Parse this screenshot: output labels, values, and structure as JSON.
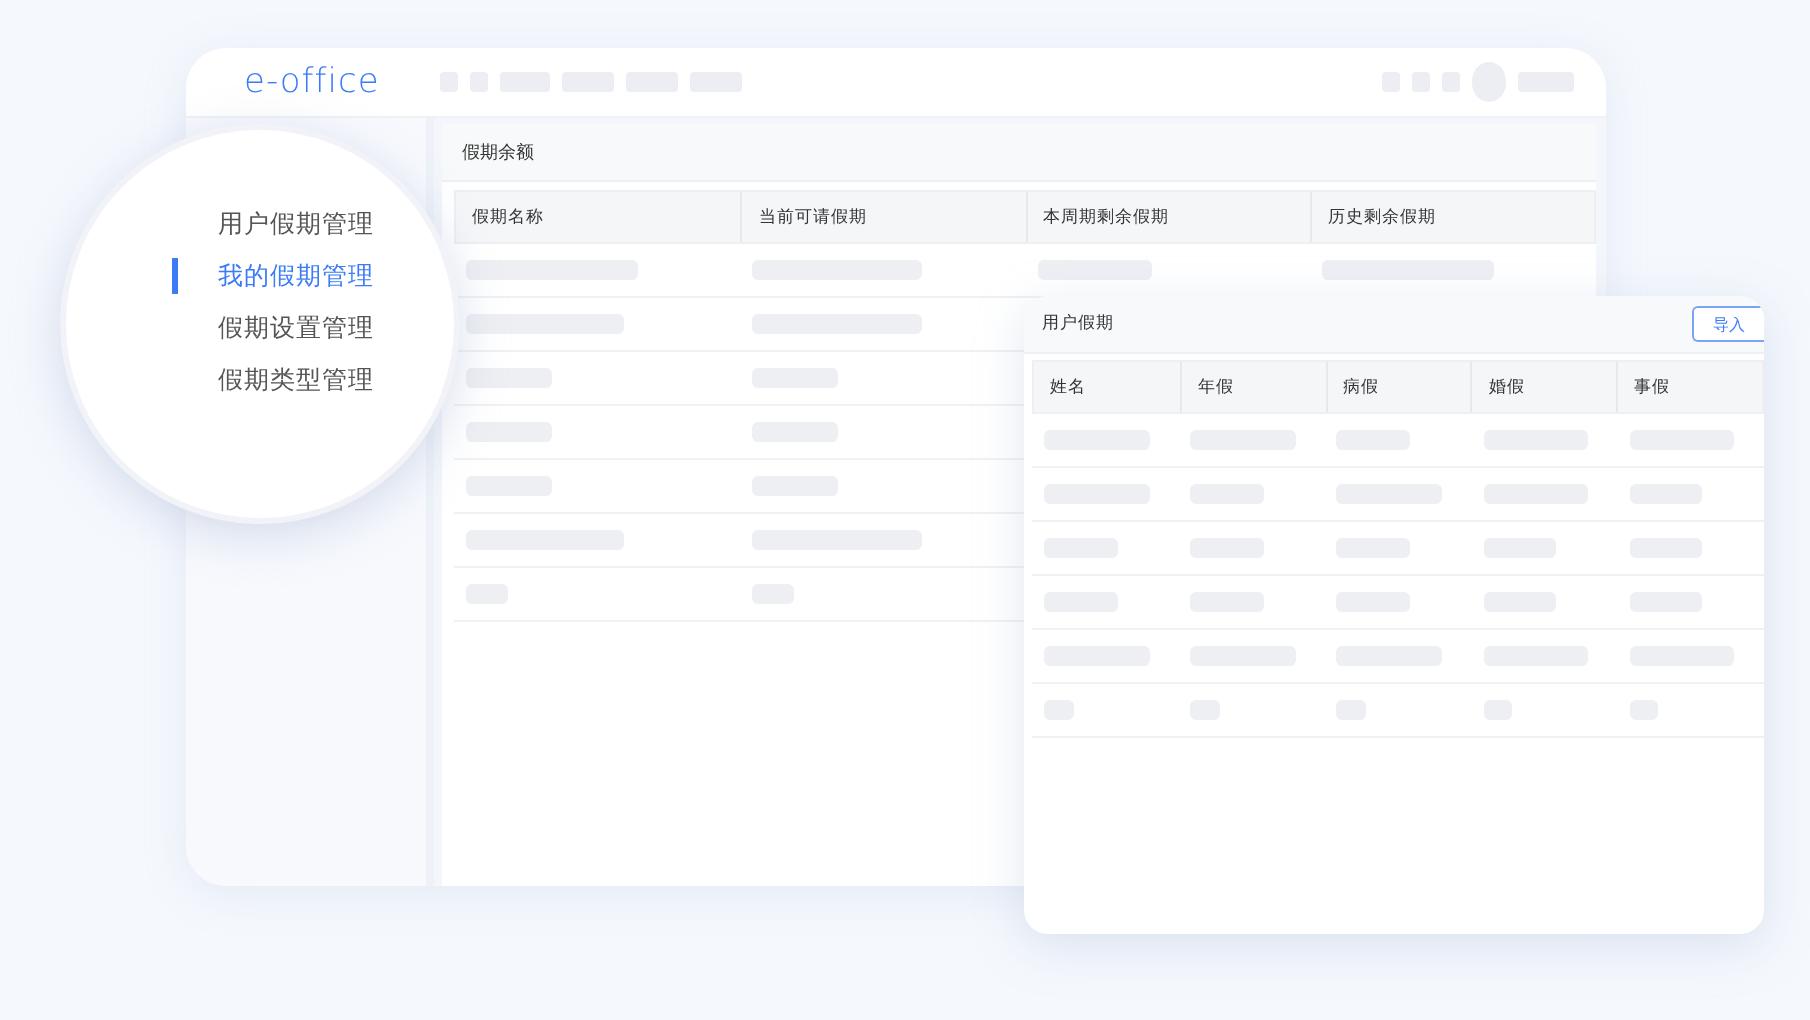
{
  "app": {
    "logo": "e-office"
  },
  "nav": {
    "items": [
      {
        "label": "用户假期管理",
        "selected": false
      },
      {
        "label": "我的假期管理",
        "selected": true
      },
      {
        "label": "假期设置管理",
        "selected": false
      },
      {
        "label": "假期类型管理",
        "selected": false
      }
    ]
  },
  "balance_panel": {
    "title": "假期余额",
    "columns": [
      "假期名称",
      "当前可请假期",
      "本周期剩余假期",
      "历史剩余假期"
    ],
    "rows": [
      {
        "kind": "skeleton"
      },
      {
        "kind": "skeleton"
      },
      {
        "kind": "skeleton"
      },
      {
        "kind": "skeleton"
      },
      {
        "kind": "skeleton"
      },
      {
        "kind": "skeleton"
      },
      {
        "kind": "skeleton"
      }
    ]
  },
  "user_panel": {
    "title": "用户假期",
    "import_button": "导入",
    "columns": [
      "姓名",
      "年假",
      "病假",
      "婚假",
      "事假"
    ],
    "rows": [
      {
        "kind": "skeleton"
      },
      {
        "kind": "skeleton"
      },
      {
        "kind": "skeleton"
      },
      {
        "kind": "skeleton"
      },
      {
        "kind": "skeleton"
      },
      {
        "kind": "skeleton"
      }
    ]
  }
}
